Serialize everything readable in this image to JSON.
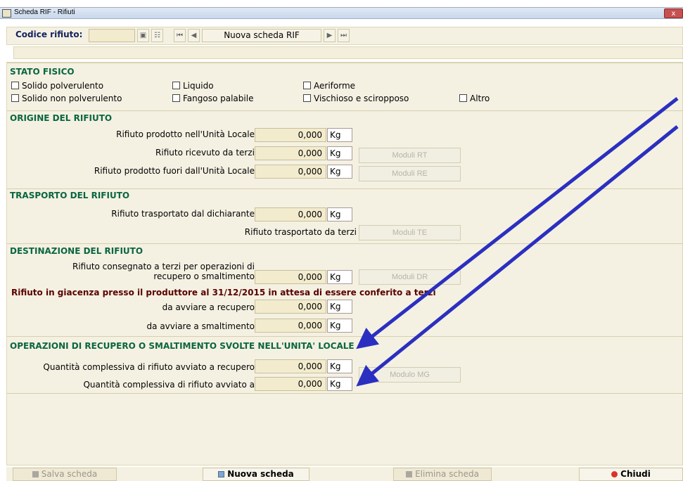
{
  "window": {
    "title": "Scheda RIF - Rifiuti",
    "close": "x"
  },
  "toolbar": {
    "code_label": "Codice rifiuto:",
    "code_value": "",
    "new_label": "Nuova scheda RIF"
  },
  "stato_fisico": {
    "title": "STATO FISICO",
    "options": [
      "Solido polverulento",
      "Liquido",
      "Aeriforme",
      "Solido non polverulento",
      "Fangoso palabile",
      "Vischioso e sciropposo",
      "Altro"
    ]
  },
  "origine": {
    "title": "ORIGINE DEL RIFIUTO",
    "rows": [
      {
        "label": "Rifiuto prodotto nell'Unità Locale",
        "value": "0,000",
        "unit": "Kg"
      },
      {
        "label": "Rifiuto ricevuto da terzi",
        "value": "0,000",
        "unit": "Kg",
        "button": "Moduli RT"
      },
      {
        "label": "Rifiuto prodotto fuori dall'Unità Locale",
        "value": "0,000",
        "unit": "Kg",
        "button": "Moduli RE"
      }
    ]
  },
  "trasporto": {
    "title": "TRASPORTO DEL RIFIUTO",
    "row1": {
      "label": "Rifiuto trasportato dal dichiarante",
      "value": "0,000",
      "unit": "Kg"
    },
    "row2": {
      "label": "Rifiuto trasportato da terzi",
      "button": "Moduli TE"
    }
  },
  "destinazione": {
    "title": "DESTINAZIONE DEL RIFIUTO",
    "row1": {
      "label_line1": "Rifiuto consegnato a terzi per operazioni di",
      "label_line2": "recupero o smaltimento",
      "value": "0,000",
      "unit": "Kg",
      "button": "Moduli DR"
    },
    "giacenza_title": "Rifiuto in giacenza presso il produttore al 31/12/2015 in attesa di essere conferito a terzi",
    "row2": {
      "label": "da avviare a recupero",
      "value": "0,000",
      "unit": "Kg"
    },
    "row3": {
      "label": "da avviare a smaltimento",
      "value": "0,000",
      "unit": "Kg"
    }
  },
  "operazioni": {
    "title": "OPERAZIONI DI RECUPERO O SMALTIMENTO SVOLTE NELL'UNITA' LOCALE",
    "row1": {
      "label": "Quantità complessiva di rifiuto avviato a recupero",
      "value": "0,000",
      "unit": "Kg"
    },
    "row2": {
      "label": "Quantità complessiva di rifiuto avviato a",
      "value": "0,000",
      "unit": "Kg"
    },
    "button": "Modulo MG"
  },
  "footer": {
    "save": "Salva scheda",
    "new": "Nuova scheda",
    "delete": "Elimina scheda",
    "close": "Chiudi"
  },
  "colors": {
    "section_title": "#0a6640",
    "form_bg": "#f4f1e2",
    "arrow": "#2b2fc0",
    "close_icon": "#d9342b"
  }
}
